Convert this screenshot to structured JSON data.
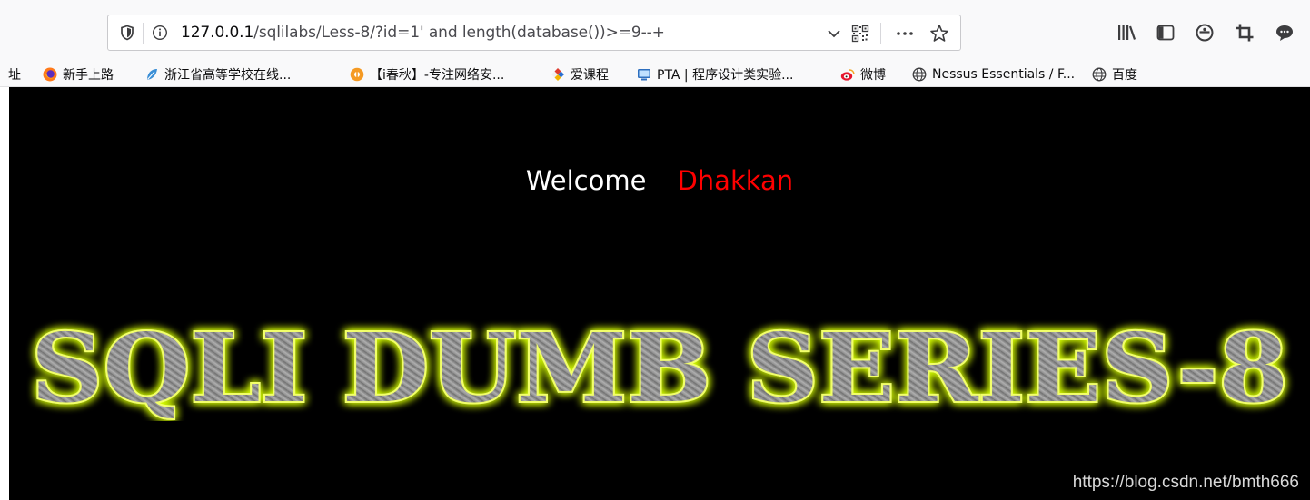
{
  "browser": {
    "url_host": "127.0.0.1",
    "url_path": "/sqlilabs/Less-8/?id=1' and length(database())>=9--+",
    "bookmarks": [
      {
        "label": "址",
        "icon": "none"
      },
      {
        "label": "新手上路",
        "icon": "firefox-icon"
      },
      {
        "label": "浙江省高等学校在线...",
        "icon": "leaf-icon"
      },
      {
        "label": "【i春秋】-专注网络安...",
        "icon": "ichunqiu-icon"
      },
      {
        "label": "爱课程",
        "icon": "icourse-icon"
      },
      {
        "label": "PTA | 程序设计类实验...",
        "icon": "pta-icon"
      },
      {
        "label": "微博",
        "icon": "weibo-icon"
      },
      {
        "label": "Nessus Essentials / F...",
        "icon": "globe-icon"
      },
      {
        "label": "百度",
        "icon": "globe-icon"
      }
    ]
  },
  "page": {
    "welcome": "Welcome",
    "name": "Dhakkan",
    "banner": "SQLI DUMB SERIES-8",
    "watermark": "https://blog.csdn.net/bmth666"
  },
  "colors": {
    "page_bg": "#000000",
    "welcome": "#ffffff",
    "name": "#ff0000",
    "banner_glow": "#e8ff1a",
    "banner_fill": "#8c8c8c"
  }
}
